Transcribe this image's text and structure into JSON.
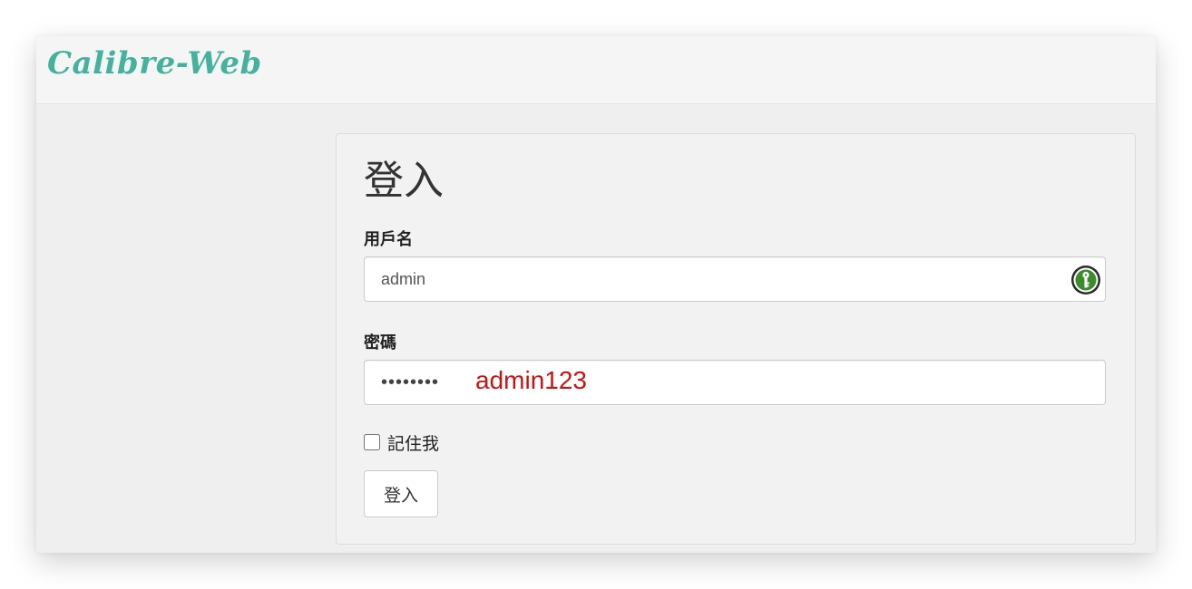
{
  "navbar": {
    "brand": "Calibre-Web"
  },
  "login": {
    "title": "登入",
    "username_label": "用戶名",
    "username_value": "admin",
    "password_label": "密碼",
    "password_value": "admin123",
    "password_masked": "••••••••",
    "password_annotation": "admin123",
    "remember_label": "記住我",
    "remember_checked": false,
    "submit_label": "登入"
  },
  "icons": {
    "password_manager": "key-icon"
  },
  "colors": {
    "brand": "#45b29d",
    "annotation": "#cc1111",
    "key_icon": "#3d8b2f"
  }
}
